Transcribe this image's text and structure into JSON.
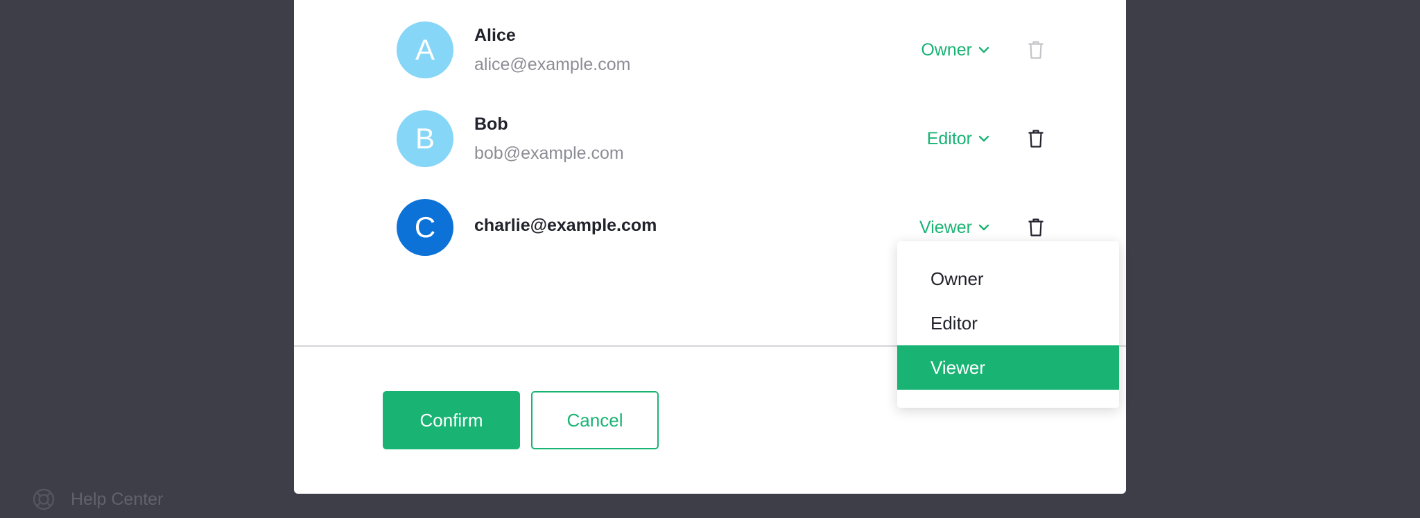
{
  "help_center": {
    "label": "Help Center",
    "icon": "lifebuoy-icon"
  },
  "members": [
    {
      "initial": "A",
      "name": "Alice",
      "email": "alice@example.com",
      "role": "Owner",
      "avatar_color": "#86d6f7",
      "delete_disabled": true
    },
    {
      "initial": "B",
      "name": "Bob",
      "email": "bob@example.com",
      "role": "Editor",
      "avatar_color": "#86d6f7",
      "delete_disabled": false
    },
    {
      "initial": "C",
      "name": "charlie@example.com",
      "role": "Viewer",
      "avatar_color": "#0c72d8",
      "delete_disabled": false
    }
  ],
  "role_dropdown": {
    "options": [
      "Owner",
      "Editor",
      "Viewer"
    ],
    "selected": "Viewer"
  },
  "footer": {
    "confirm_label": "Confirm",
    "cancel_label": "Cancel"
  },
  "colors": {
    "accent": "#19b374",
    "overlay": "#3e3e48",
    "text_primary": "#22222c",
    "text_secondary": "#8c8c96"
  }
}
